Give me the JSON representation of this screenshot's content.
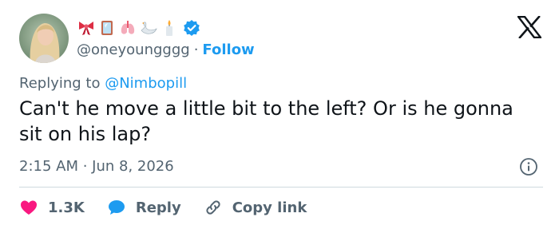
{
  "author": {
    "handle": "@oneyoungggg",
    "emojis": [
      "bow-icon",
      "mirror-icon",
      "lungs-icon",
      "swan-icon",
      "candle-icon"
    ],
    "verified": true
  },
  "header": {
    "separator": "·",
    "follow_label": "Follow"
  },
  "reply_context": {
    "prefix": "Replying to",
    "mention": "@Nimbopill"
  },
  "tweet": {
    "text": "Can't he move a little bit to the left? Or is he gonna sit on his lap?",
    "timestamp": "2:15 AM · Jun 8, 2026"
  },
  "actions": {
    "like_count": "1.3K",
    "reply_label": "Reply",
    "copy_label": "Copy link"
  },
  "colors": {
    "accent": "#1d9bf0",
    "like": "#f91880",
    "muted": "#536471",
    "text": "#0f1419"
  }
}
